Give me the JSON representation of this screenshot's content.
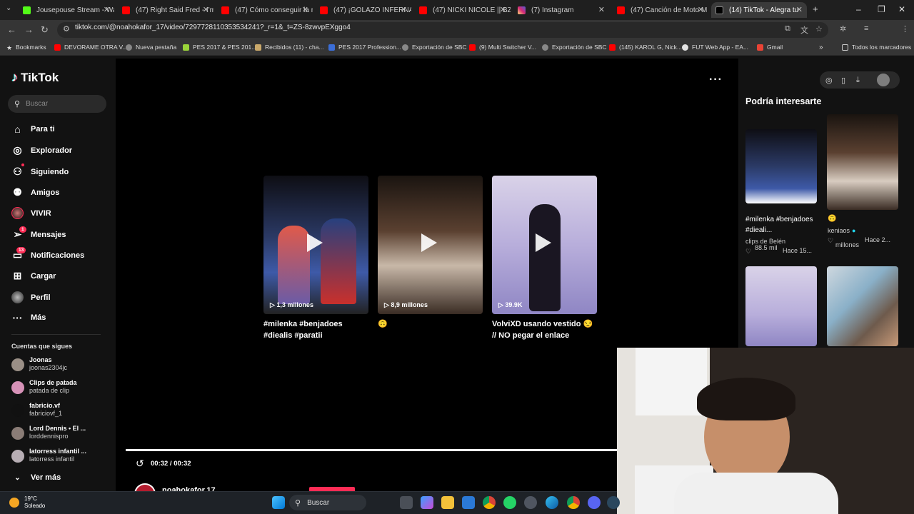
{
  "browser": {
    "tabs": [
      {
        "title": "Jousepouse Stream - Wat",
        "color": "#53fc18"
      },
      {
        "title": "(47) Right Said Fred - I'm",
        "color": "#ff0000"
      },
      {
        "title": "(47) Cómo conseguir la m",
        "color": "#ff0000"
      },
      {
        "title": "(47) ¡GOLAZO INFERNAL",
        "color": "#ff0000"
      },
      {
        "title": "(47) NICKI NICOLE || BZR",
        "color": "#ff0000"
      },
      {
        "title": "(7) Instagram",
        "color": "#d62976"
      },
      {
        "title": "(47) Canción de Moto M",
        "color": "#ff0000"
      },
      {
        "title": "(14) TikTok - Alegra tu",
        "color": "#ffffff"
      }
    ],
    "url": "tiktok.com/@noahokafor_17/video/7297728110353534241?_r=1&_t=ZS-8zwvpEXggo4",
    "bookmarks": [
      "Bookmarks",
      "DEVORAME OTRA V...",
      "Nueva pestaña",
      "PES 2017 & PES 201...",
      "Recibidos (11) - cha...",
      "PES 2017 Profession...",
      "Exportación de SBC",
      "(9) Multi Switcher V...",
      "Exportación de SBC",
      "(145) KAROL G, Nick...",
      "FUT Web App - EA...",
      "Gmail"
    ],
    "all_bookmarks": "Todos los marcadores"
  },
  "sidebar": {
    "logo": "TikTok",
    "search_placeholder": "Buscar",
    "nav": [
      {
        "label": "Para ti",
        "icon": "home-icon"
      },
      {
        "label": "Explorador",
        "icon": "compass-icon"
      },
      {
        "label": "Siguiendo",
        "icon": "following-icon"
      },
      {
        "label": "Amigos",
        "icon": "friends-icon"
      },
      {
        "label": "VIVIR",
        "icon": "live-icon"
      },
      {
        "label": "Mensajes",
        "icon": "messages-icon",
        "badge": "1"
      },
      {
        "label": "Notificaciones",
        "icon": "notifications-icon",
        "badge": "13"
      },
      {
        "label": "Cargar",
        "icon": "upload-icon"
      },
      {
        "label": "Perfil",
        "icon": "profile-icon"
      },
      {
        "label": "Más",
        "icon": "more-icon"
      }
    ],
    "following_header": "Cuentas que sigues",
    "accounts": [
      {
        "name": "Joonas",
        "handle": "joonas2304jc"
      },
      {
        "name": "Clips de patada",
        "handle": "patada de clip"
      },
      {
        "name": "fabricio.vf",
        "handle": "fabriciovf_1"
      },
      {
        "name": "Lord Dennis • El ...",
        "handle": "lorddennispro"
      },
      {
        "name": "latorress infantil ...",
        "handle": "latorress infantil"
      }
    ],
    "see_more": "Ver más"
  },
  "player": {
    "cards": [
      {
        "views": "1,3 millones",
        "caption": "#milenka #benjadoes #diealis #paratii"
      },
      {
        "views": "8,9 millones",
        "caption": "🙃"
      },
      {
        "views": "39.9K",
        "caption": "VolviXD usando vestido 😒 // NO pegar el enlace"
      }
    ],
    "time": "00:32 / 00:32",
    "progress": 0.985,
    "author": "noahokafor.17"
  },
  "right": {
    "heading": "Podría interesarte",
    "items": [
      {
        "caption": "#milenka #benjadoes #dieali...",
        "author": "clips de Belén",
        "likes": "88.5 mil",
        "age": "Hace 15..."
      },
      {
        "caption": "🙃",
        "author": "keniaos",
        "likes": "millones",
        "age": "Hace 2..."
      }
    ]
  },
  "taskbar": {
    "temp": "19°C",
    "weather": "Soleado",
    "search": "Buscar"
  }
}
